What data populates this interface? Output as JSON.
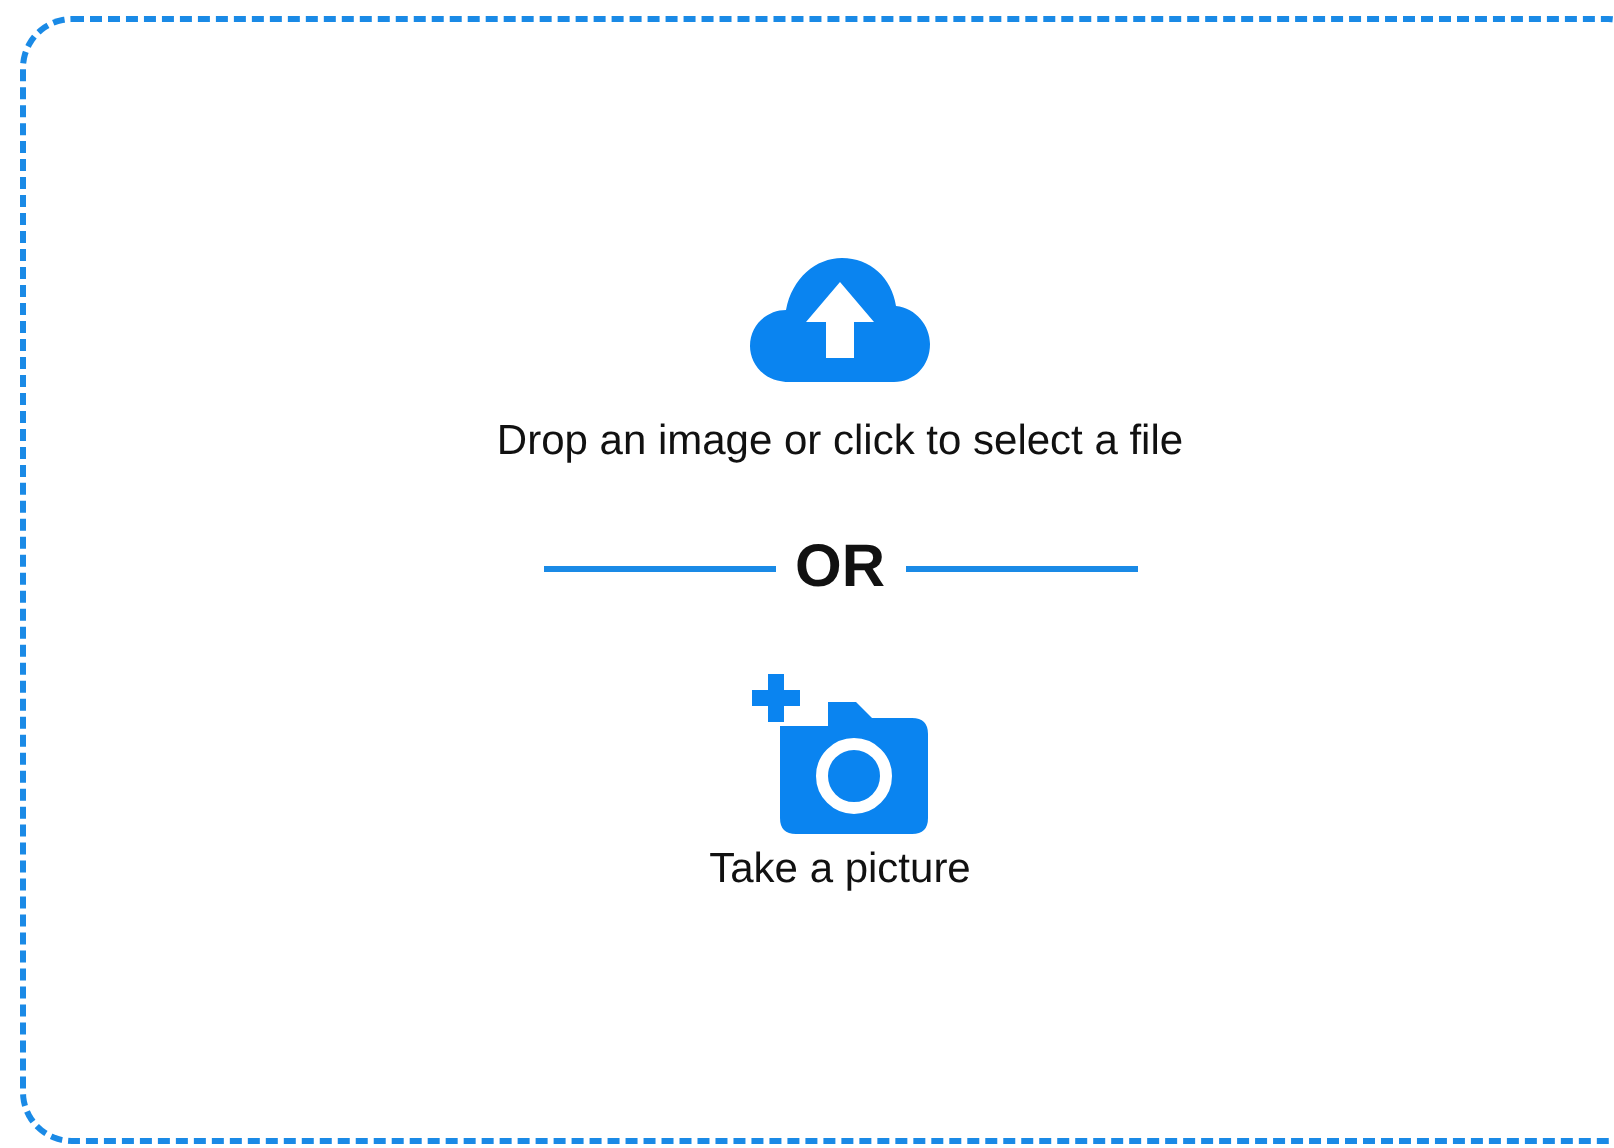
{
  "upload_option": {
    "label": "Drop an image or click to select a file"
  },
  "divider": {
    "label": "OR"
  },
  "camera_option": {
    "label": "Take a picture"
  }
}
